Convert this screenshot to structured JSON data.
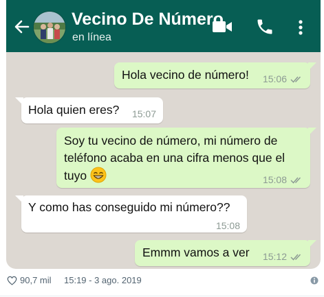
{
  "header": {
    "contact_name": "Vecino De Número",
    "status": "en línea",
    "icons": [
      "back-arrow-icon",
      "video-call-icon",
      "phone-icon",
      "more-options-icon"
    ],
    "color": "#075e54"
  },
  "messages": [
    {
      "direction": "outgoing",
      "text": "Hola vecino de número!",
      "time": "15:06",
      "read": true
    },
    {
      "direction": "incoming",
      "text": "Hola quien eres?",
      "time": "15:07"
    },
    {
      "direction": "outgoing",
      "lines": [
        "Soy tu vecino de número, mi número de",
        "teléfono acaba en una cifra menos que el",
        "tuyo"
      ],
      "emoji": "grinning-face-with-smiling-eyes",
      "time": "15:08",
      "read": true
    },
    {
      "direction": "incoming",
      "text": "Y como has conseguido mi número??",
      "time": "15:08"
    },
    {
      "direction": "outgoing",
      "text": "Emmm vamos a ver",
      "time": "15:12",
      "read": true
    }
  ],
  "colors": {
    "outgoing_bubble": "#dcf8c6",
    "incoming_bubble": "#ffffff",
    "chat_background": "#ddd8d2"
  },
  "tweet_footer": {
    "likes": "90,7 mil",
    "timestamp": "15:19 - 3 ago. 2019"
  }
}
